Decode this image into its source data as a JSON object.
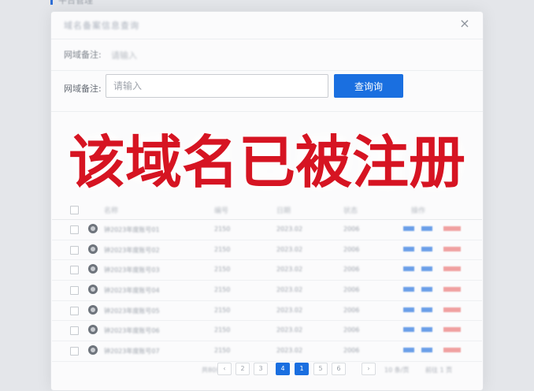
{
  "top_tab": {
    "label": "平台管理"
  },
  "dialog": {
    "title": "域名备案信息查询",
    "close_label": "×"
  },
  "ghost_row": {
    "label": "网域备注:",
    "placeholder": "请输入"
  },
  "search": {
    "label": "网域备注:",
    "placeholder": "请输入",
    "button_label": "查询询"
  },
  "banner": {
    "text": "该域名已被注册"
  },
  "table": {
    "headers": [
      "名称",
      "编号",
      "日期",
      "状态",
      "操作"
    ],
    "rows": [
      {
        "name": "钟2023年度账号01",
        "code": "2150",
        "date": "2023.02",
        "status": "2006"
      },
      {
        "name": "钟2023年度账号02",
        "code": "2150",
        "date": "2023.02",
        "status": "2006"
      },
      {
        "name": "钟2023年度账号03",
        "code": "2150",
        "date": "2023.02",
        "status": "2006"
      },
      {
        "name": "钟2023年度账号04",
        "code": "2150",
        "date": "2023.02",
        "status": "2006"
      },
      {
        "name": "钟2023年度账号05",
        "code": "2150",
        "date": "2023.02",
        "status": "2006"
      },
      {
        "name": "钟2023年度账号06",
        "code": "2150",
        "date": "2023.02",
        "status": "2006"
      },
      {
        "name": "钟2023年度账号07",
        "code": "2150",
        "date": "2023.02",
        "status": "2006"
      }
    ]
  },
  "pagination": {
    "total_label": "共80条",
    "prev": "‹",
    "pages": [
      "2",
      "3",
      "4",
      "1",
      "5",
      "6"
    ],
    "next": "›",
    "per_page": "10 条/页",
    "goto": "前往 1 页"
  },
  "colors": {
    "accent": "#1a6fe0",
    "banner_red": "#d61422"
  }
}
